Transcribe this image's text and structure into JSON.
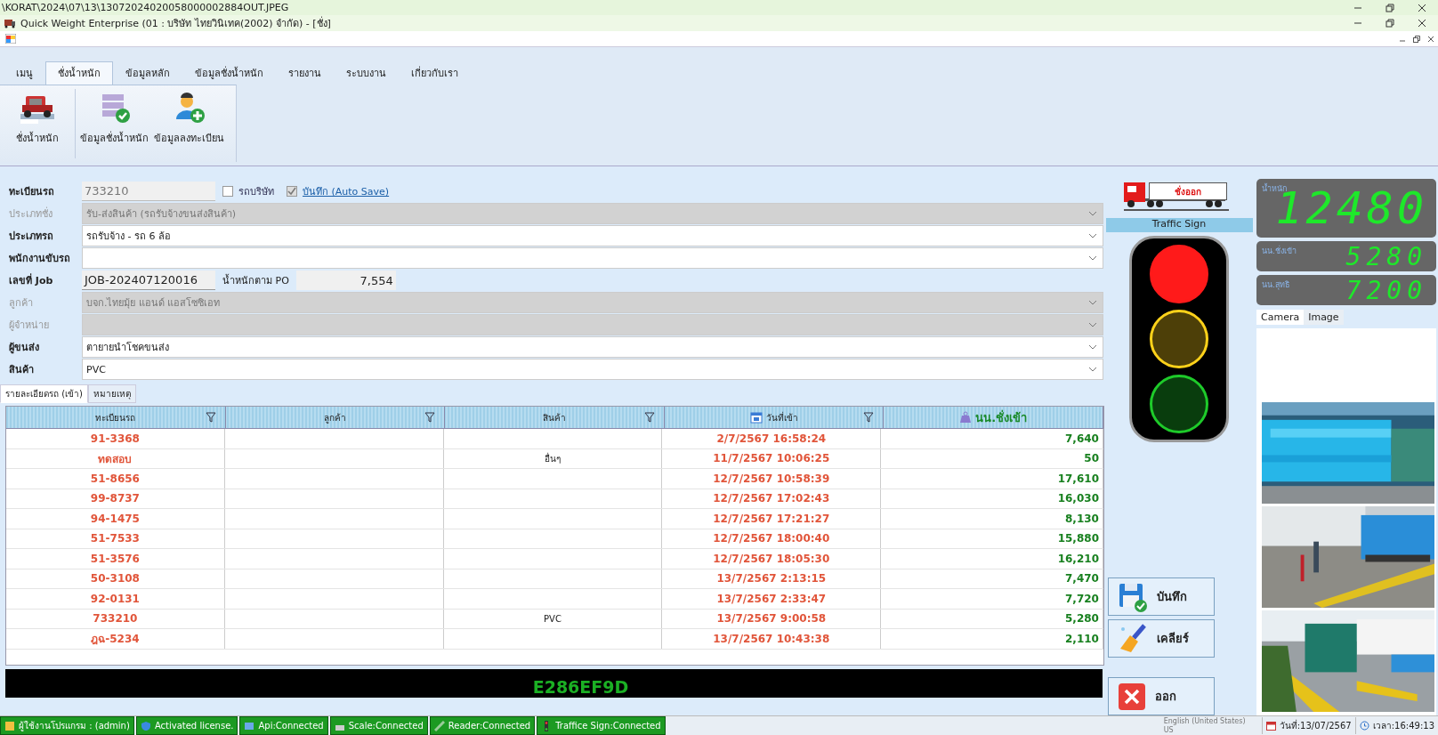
{
  "window": {
    "path": "\\KORAT\\2024\\07\\13\\1307202402005800000288​4OUT.JPEG",
    "title": "Quick Weight Enterprise (01 : บริษัท ไทยวินิเทค(2002) จำกัด) - [ชั่ง]"
  },
  "ribbon_tabs": [
    {
      "label": "เมนู",
      "selected": false
    },
    {
      "label": "ชั่งน้ำหนัก",
      "selected": true
    },
    {
      "label": "ข้อมูลหลัก",
      "selected": false
    },
    {
      "label": "ข้อมูลชั่งน้ำหนัก",
      "selected": false
    },
    {
      "label": "รายงาน",
      "selected": false
    },
    {
      "label": "ระบบงาน",
      "selected": false
    },
    {
      "label": "เกี่ยวกับเรา",
      "selected": false
    }
  ],
  "ribbon_buttons": [
    {
      "label": "ชั่งน้ำหนัก",
      "kind": "truck"
    },
    {
      "label": "ข้อมูลชั่งน้ำหนัก",
      "kind": "list"
    },
    {
      "label": "ข้อมูลลงทะเบียน",
      "kind": "person"
    }
  ],
  "form": [
    {
      "label": "ทะเบียนรถ",
      "value": "733210",
      "kind": "plate",
      "disabled": false
    },
    {
      "label": "ประเภทชั่ง",
      "value": "รับ-ส่งสินค้า (รถรับจ้างขนส่งสินค้า)",
      "kind": "combo",
      "disabled": true
    },
    {
      "label": "ประเภทรถ",
      "value": "รถรับจ้าง - รถ 6 ล้อ",
      "kind": "combo",
      "disabled": false
    },
    {
      "label": "พนักงานขับรถ",
      "kind": "combo",
      "disabled": false
    },
    {
      "label": "เลขที่ Job",
      "value": "JOB-202407120016",
      "kind": "job",
      "disabled": false
    },
    {
      "label": "ลูกค้า",
      "value": "บจก.ไทยมุ้ย แอนด์ แอสโซซิเอท",
      "kind": "combo",
      "disabled": true
    },
    {
      "label": "ผู้จำหน่าย",
      "kind": "combo",
      "disabled": true
    },
    {
      "label": "ผู้ขนส่ง",
      "value": "ตายายนำโชคขนส่ง",
      "kind": "combo",
      "disabled": false
    },
    {
      "label": "สินค้า",
      "value": "PVC",
      "kind": "combo",
      "disabled": false
    }
  ],
  "company_car": {
    "label": "รถบริษัท",
    "checked": false
  },
  "auto_save": {
    "label": "บันทึก (Auto Save)",
    "checked": true
  },
  "po_weight": {
    "label": "น้ำหนักตาม PO",
    "value": "7,554"
  },
  "detail_tabs": [
    {
      "label": "รายละเอียดรถ (เข้า)",
      "selected": true
    },
    {
      "label": "หมายเหตุ",
      "selected": false
    }
  ],
  "table": {
    "columns": [
      "ทะเบียนรถ",
      "ลูกค้า",
      "สินค้า",
      "วันที่เข้า",
      "นน.ชั่งเข้า"
    ],
    "rows": [
      [
        "91-3368",
        "",
        "",
        "2/7/2567 16:58:24",
        "7,640"
      ],
      [
        "ทดสอบ",
        "",
        "อื่นๆ",
        "11/7/2567 10:06:25",
        "50"
      ],
      [
        "51-8656",
        "",
        "",
        "12/7/2567 10:58:39",
        "17,610"
      ],
      [
        "99-8737",
        "",
        "",
        "12/7/2567 17:02:43",
        "16,030"
      ],
      [
        "94-1475",
        "",
        "",
        "12/7/2567 17:21:27",
        "8,130"
      ],
      [
        "51-7533",
        "",
        "",
        "12/7/2567 18:00:40",
        "15,880"
      ],
      [
        "51-3576",
        "",
        "",
        "12/7/2567 18:05:30",
        "16,210"
      ],
      [
        "50-3108",
        "",
        "",
        "13/7/2567 2:13:15",
        "7,470"
      ],
      [
        "92-0131",
        "",
        "",
        "13/7/2567 2:33:47",
        "7,720"
      ],
      [
        "733210",
        "",
        "PVC",
        "13/7/2567 9:00:58",
        "5,280"
      ],
      [
        "ฎฉ-5234",
        "",
        "",
        "13/7/2567 10:43:38",
        "2,110"
      ]
    ]
  },
  "tag_reader": "E286EF9D",
  "sign": {
    "label": "ชั่งออก"
  },
  "traffic_sign": {
    "title": "Traffic Sign",
    "lamps": [
      {
        "color": "#ff1a1a",
        "on": true
      },
      {
        "color": "#ffd21a",
        "on": false
      },
      {
        "color": "#1ecb2a",
        "on": false
      }
    ]
  },
  "displays": [
    {
      "label": "น้ำหนัก",
      "value": "12480"
    },
    {
      "label": "นน.ชั่งเข้า",
      "value": "5280"
    },
    {
      "label": "นน.สุทธิ",
      "value": "7200"
    }
  ],
  "camera_tabs": [
    {
      "label": "Camera",
      "selected": true
    },
    {
      "label": "Image",
      "selected": false
    }
  ],
  "actions": [
    {
      "label": "บันทึก",
      "kind": "save"
    },
    {
      "label": "เคลียร์",
      "kind": "clear"
    },
    {
      "label": "ออก",
      "kind": "exit"
    }
  ],
  "status_bar": {
    "items": [
      {
        "label": "ผู้ใช้งานโปรแกรม : (admin)",
        "kind": "user"
      },
      {
        "label": "Activated license.",
        "kind": "shield"
      },
      {
        "label": "Api:Connected",
        "kind": "api"
      },
      {
        "label": "Scale:Connected",
        "kind": "scale"
      },
      {
        "label": "Reader:Connected",
        "kind": "reader"
      },
      {
        "label": "Traffice Sign:Connected",
        "kind": "traffic"
      }
    ],
    "language": "English (United States)",
    "layout": "US",
    "date": "วันที่:13/07/2567",
    "time": "เวลา:16:49:13"
  }
}
